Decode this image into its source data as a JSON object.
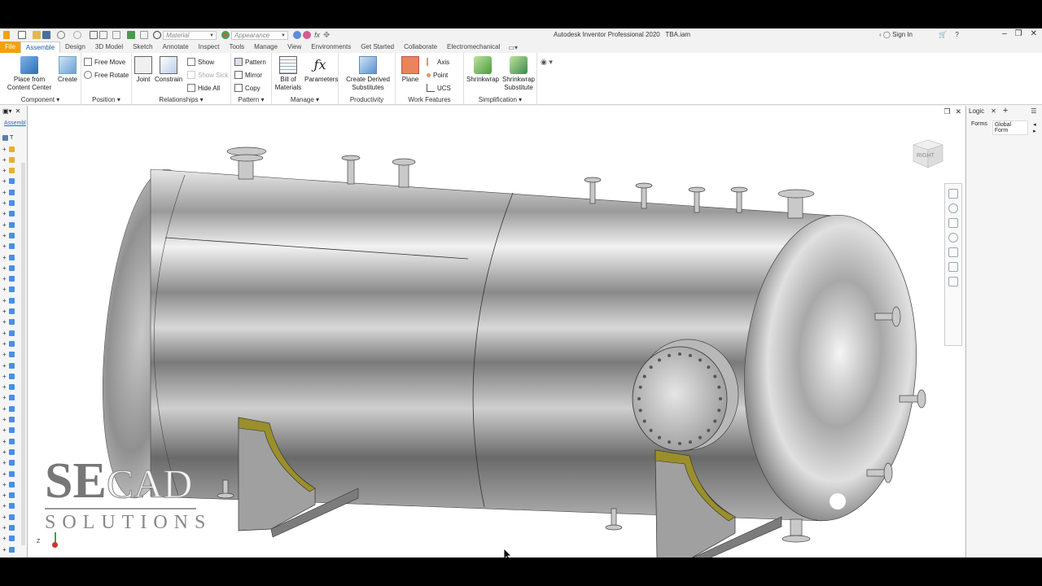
{
  "title_bar": {
    "material_placeholder": "Material",
    "appearance_placeholder": "Appearance",
    "app_title": "Autodesk Inventor Professional 2020",
    "file_name": "TBA.iam",
    "sign_in": "Sign In"
  },
  "tabs": [
    "File",
    "Assemble",
    "Design",
    "3D Model",
    "Sketch",
    "Annotate",
    "Inspect",
    "Tools",
    "Manage",
    "View",
    "Environments",
    "Get Started",
    "Collaborate",
    "Electromechanical"
  ],
  "ribbon": {
    "component": {
      "label": "Component",
      "place_line1": "Place from",
      "place_line2": "Content Center",
      "create": "Create"
    },
    "position": {
      "label": "Position",
      "free_move": "Free Move",
      "free_rotate": "Free Rotate"
    },
    "relationships": {
      "label": "Relationships",
      "joint": "Joint",
      "constrain": "Constrain",
      "show": "Show",
      "show_sick": "Show Sick",
      "hide_all": "Hide All"
    },
    "pattern": {
      "label": "Pattern",
      "pattern": "Pattern",
      "mirror": "Mirror",
      "copy": "Copy"
    },
    "manage": {
      "label": "Manage",
      "bom_line1": "Bill of",
      "bom_line2": "Materials",
      "parameters": "Parameters"
    },
    "productivity": {
      "label": "Productivity",
      "derived_line1": "Create Derived",
      "derived_line2": "Substitutes"
    },
    "work_features": {
      "label": "Work Features",
      "plane": "Plane",
      "axis": "Axis",
      "point": "Point",
      "ucs": "UCS"
    },
    "simplification": {
      "label": "Simplification",
      "shrinkwrap": "Shrinkwrap",
      "shrinkwrap_sub_line1": "Shrinkwrap",
      "shrinkwrap_sub_line2": "Substitute"
    }
  },
  "browser": {
    "tab_label": "Assembl",
    "header_label": "T"
  },
  "right_panel": {
    "title": "Logic",
    "tab_forms": "Forms",
    "tab_global": "Global Form"
  },
  "viewcube": {
    "face_label": "RIGHT"
  },
  "logo": {
    "line1_a": "SE",
    "line1_b": "CAD",
    "line2": "SOLUTIONS"
  },
  "triad": {
    "z": "Z"
  },
  "colors": {
    "file_tab": "#f0a30a",
    "accent_blue": "#1a5fa8",
    "saddle_pad": "#9a8f2a",
    "vessel_steel": "#b8b8b8"
  }
}
